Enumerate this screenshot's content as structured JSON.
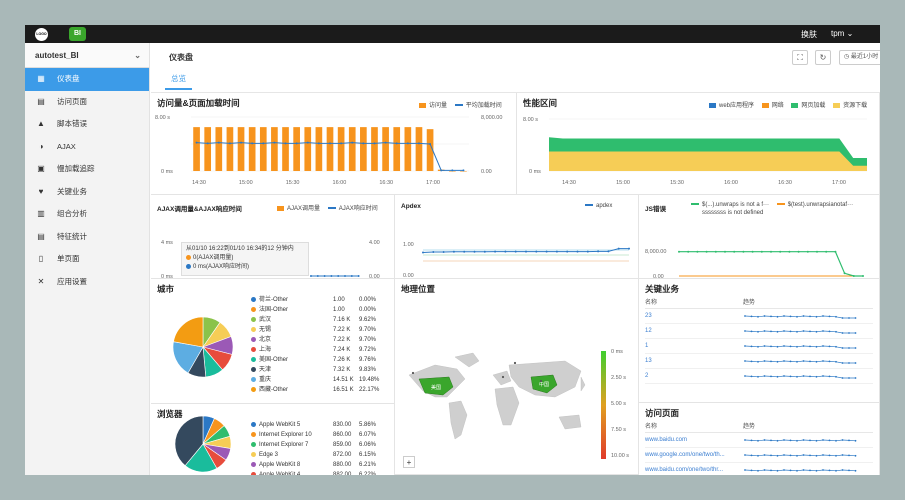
{
  "topbar": {
    "logo1": "LOGO",
    "logo2": "BI",
    "skin": "换肤",
    "user": "tpm"
  },
  "sidebar": {
    "app": "autotest_BI",
    "items": [
      {
        "label": "仪表盘",
        "icon": "grid-icon",
        "glyph": "▦",
        "active": true
      },
      {
        "label": "访问页面",
        "icon": "page-icon",
        "glyph": "▤"
      },
      {
        "label": "脚本错误",
        "icon": "warning-icon",
        "glyph": "▲"
      },
      {
        "label": "AJAX",
        "icon": "ajax-icon",
        "glyph": "◑"
      },
      {
        "label": "慢加载追踪",
        "icon": "slow-load-icon",
        "glyph": "▣"
      },
      {
        "label": "关键业务",
        "icon": "heartbeat-icon",
        "glyph": "♥"
      },
      {
        "label": "组合分析",
        "icon": "combo-chart-icon",
        "glyph": "▥"
      },
      {
        "label": "特征统计",
        "icon": "stats-icon",
        "glyph": "▤"
      },
      {
        "label": "单页面",
        "icon": "single-page-icon",
        "glyph": "▯"
      },
      {
        "label": "应用设置",
        "icon": "wrench-icon",
        "glyph": "✕"
      }
    ]
  },
  "header": {
    "title": "仪表盘",
    "tab": "总览",
    "time_range": "最近1小时"
  },
  "colors": {
    "accent": "#3c9be8",
    "orange": "#f7941d",
    "blue": "#2b78c5",
    "green": "#2fbd6e",
    "yellow": "#f6cd56"
  },
  "panels": {
    "visits": {
      "title": "访问量&页面加载时间",
      "legend": [
        "访问量",
        "平均加载时间"
      ],
      "y_left": [
        "8.00 s",
        "0 ms"
      ],
      "y_right": [
        "8,000.00",
        "0.00"
      ],
      "x": [
        "14:30",
        "15:00",
        "15:30",
        "16:00",
        "16:30",
        "17:00"
      ]
    },
    "perf": {
      "title": "性能区间",
      "legend": [
        "web应用程序",
        "网络",
        "网页加载",
        "资源下载"
      ],
      "y": [
        "8.00 s",
        "0 ms"
      ],
      "x": [
        "14:30",
        "15:00",
        "15:30",
        "16:00",
        "16:30",
        "17:00"
      ]
    },
    "ajax": {
      "title": "AJAX调用量&AJAX响应时间",
      "legend": [
        "AJAX调用量",
        "AJAX响应时间"
      ],
      "y_left": [
        "4 ms",
        "0 ms"
      ],
      "y_right": [
        "4.00",
        "0.00"
      ],
      "x": [
        "17:00"
      ],
      "tooltip": {
        "line1": "从01/10 16:22到01/10 16:34的12 分钟内",
        "line2": "0(AJAX调用量)",
        "line3": "0 ms(AJAX响应时间)"
      }
    },
    "apdex": {
      "title": "Apdex",
      "legend": "apdex",
      "y": [
        "1.00",
        "0.00"
      ],
      "x": [
        "14:30",
        "15:00",
        "15:30",
        "16:00",
        "16:30",
        "17:00"
      ]
    },
    "js": {
      "title": "JS错误",
      "legend": [
        "$(...).unwraps is not a f···",
        "$(test).unwrapsianotaf···",
        "ssssssss is not defined"
      ],
      "y": [
        "8,000.00",
        "0.00"
      ],
      "x": [
        "14:30",
        "15:00",
        "15:30",
        "16:00",
        "16:30",
        "17:00"
      ]
    },
    "city": {
      "title": "城市",
      "rows": [
        {
          "name": "荷兰-Other",
          "v": "1.00",
          "p": "0.00%",
          "c": "#2b78c5"
        },
        {
          "name": "法国-Other",
          "v": "1.00",
          "p": "0.00%",
          "c": "#f7941d"
        },
        {
          "name": "武汉",
          "v": "7.16 K",
          "p": "9.62%",
          "c": "#8bc34a"
        },
        {
          "name": "无锡",
          "v": "7.22 K",
          "p": "9.70%",
          "c": "#f6cd56"
        },
        {
          "name": "北京",
          "v": "7.22 K",
          "p": "9.70%",
          "c": "#9b59b6"
        },
        {
          "name": "上海",
          "v": "7.24 K",
          "p": "9.72%",
          "c": "#e74c3c"
        },
        {
          "name": "美国-Other",
          "v": "7.26 K",
          "p": "9.76%",
          "c": "#1abc9c"
        },
        {
          "name": "天津",
          "v": "7.32 K",
          "p": "9.83%",
          "c": "#34495e"
        },
        {
          "name": "重庆",
          "v": "14.51 K",
          "p": "19.48%",
          "c": "#5dade2"
        },
        {
          "name": "西藏-Other",
          "v": "16.51 K",
          "p": "22.17%",
          "c": "#f39c12"
        }
      ]
    },
    "geo": {
      "title": "地理位置",
      "scale": [
        "0 ms",
        "2.50 s",
        "5.00 s",
        "7.50 s",
        "10.00 s"
      ],
      "labels": [
        "美国",
        "中国"
      ],
      "zoom": "+"
    },
    "business": {
      "title": "关键业务",
      "cols": [
        "名称",
        "趋势"
      ],
      "rows": [
        "23",
        "12",
        "1",
        "13",
        "2"
      ]
    },
    "browser": {
      "title": "浏览器",
      "rows": [
        {
          "name": "Apple WebKit 5",
          "v": "830.00",
          "p": "5.86%",
          "c": "#2b78c5"
        },
        {
          "name": "Internet Explorer 10",
          "v": "860.00",
          "p": "6.07%",
          "c": "#f7941d"
        },
        {
          "name": "Internet Explorer 7",
          "v": "859.00",
          "p": "6.06%",
          "c": "#2fbd6e"
        },
        {
          "name": "Edge 3",
          "v": "872.00",
          "p": "6.15%",
          "c": "#f6cd56"
        },
        {
          "name": "Apple WebKit 8",
          "v": "880.00",
          "p": "6.21%",
          "c": "#9b59b6"
        },
        {
          "name": "Apple WebKit 4",
          "v": "882.00",
          "p": "6.22%",
          "c": "#e74c3c"
        },
        {
          "name": "Chrome 0",
          "v": "2.38 K",
          "p": "16.78%",
          "c": "#1abc9c"
        },
        {
          "name": "Opera 6",
          "v": "4.83 K",
          "p": "34.12%",
          "c": "#34495e"
        }
      ]
    },
    "pages": {
      "title": "访问页面",
      "cols": [
        "名称",
        "趋势"
      ],
      "rows": [
        "www.baidu.com",
        "www.google.com/one/two/th...",
        "www.baidu.com/one/two/thr...",
        "www.xinlang.com/one/two/t..."
      ]
    }
  },
  "chart_data": [
    {
      "type": "bar",
      "title": "访问量&页面加载时间",
      "series": [
        {
          "name": "访问量",
          "values": [
            6500,
            6500,
            6500,
            6500,
            6500,
            6500,
            6500,
            6500,
            6500,
            6500,
            6500,
            6500,
            6500,
            6500,
            6500,
            6500,
            6500,
            6500,
            6500,
            6500,
            6500,
            6200,
            200,
            0,
            0
          ]
        },
        {
          "name": "平均加载时间",
          "values": [
            4.2,
            4.1,
            4.2,
            4.1,
            4.2,
            4.1,
            4.1,
            4.2,
            4.1,
            4.1,
            4.2,
            4.1,
            4.1,
            4.1,
            4.2,
            4.1,
            4.1,
            4.2,
            4.1,
            4.1,
            4.1,
            4.0,
            0.1,
            0.1,
            0.1
          ]
        }
      ],
      "ylim": [
        0,
        8000
      ]
    },
    {
      "type": "area",
      "title": "性能区间",
      "series": [
        {
          "name": "web应用程序",
          "values": [
            5.2,
            5.0,
            5.0,
            5.0,
            5.0,
            5.0,
            5.0,
            5.0,
            5.0,
            5.0,
            5.0,
            5.0,
            5.0,
            5.0,
            5.0,
            5.0,
            5.0,
            5.0,
            5.0,
            5.0,
            5.0,
            5.0,
            2.0,
            2.0
          ]
        },
        {
          "name": "资源下载",
          "values": [
            3.0,
            3.0,
            3.0,
            3.0,
            3.0,
            3.0,
            3.0,
            3.0,
            3.0,
            3.0,
            3.0,
            3.0,
            3.0,
            3.0,
            3.0,
            3.0,
            3.0,
            3.0,
            3.0,
            3.0,
            3.0,
            3.0,
            0.8,
            0.8
          ]
        }
      ],
      "ylim": [
        0,
        8
      ]
    },
    {
      "type": "line",
      "title": "Apdex",
      "series": [
        {
          "name": "apdex",
          "values": [
            0.83,
            0.85,
            0.85,
            0.86,
            0.86,
            0.86,
            0.86,
            0.87,
            0.87,
            0.87,
            0.87,
            0.87,
            0.87,
            0.87,
            0.87,
            0.87,
            0.87,
            0.88,
            0.88,
            1.0,
            1.0
          ]
        }
      ],
      "ylim": [
        0,
        1
      ]
    },
    {
      "type": "line",
      "title": "JS错误",
      "series": [
        {
          "name": "$(...).unwraps is not a f···",
          "values": [
            7200,
            7200,
            7200,
            7200,
            7200,
            7200,
            7200,
            7200,
            7200,
            7200,
            7200,
            7200,
            7200,
            7200,
            7200,
            7200,
            7200,
            7200,
            800,
            0,
            0
          ]
        },
        {
          "name": "$(test).unwrapsianotaf···",
          "values": [
            0,
            0,
            0,
            0,
            0,
            0,
            0,
            0,
            0,
            0,
            0,
            0,
            0,
            0,
            0,
            0,
            0,
            0,
            0,
            0,
            0
          ]
        }
      ],
      "ylim": [
        0,
        8000
      ]
    },
    {
      "type": "pie",
      "title": "城市",
      "values": [
        0.0,
        0.0,
        9.62,
        9.7,
        9.7,
        9.72,
        9.76,
        9.83,
        19.48,
        22.17
      ]
    },
    {
      "type": "pie",
      "title": "浏览器",
      "values": [
        5.86,
        6.07,
        6.06,
        6.15,
        6.21,
        6.22,
        16.78,
        34.12
      ]
    }
  ]
}
